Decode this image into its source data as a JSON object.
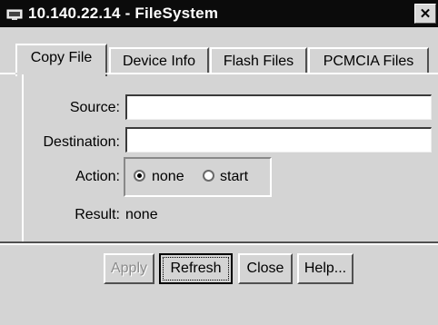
{
  "window": {
    "title": "10.140.22.14 - FileSystem",
    "close_glyph": "✕",
    "icon": "monitor-icon"
  },
  "tabs": [
    {
      "label": "Copy File",
      "active": true
    },
    {
      "label": "Device Info",
      "active": false
    },
    {
      "label": "Flash Files",
      "active": false
    },
    {
      "label": "PCMCIA Files",
      "active": false
    }
  ],
  "copy_file": {
    "source_label": "Source:",
    "source_value": "",
    "destination_label": "Destination:",
    "destination_value": "",
    "action_label": "Action:",
    "action_options": [
      {
        "label": "none",
        "selected": true
      },
      {
        "label": "start",
        "selected": false
      }
    ],
    "result_label": "Result:",
    "result_value": "none"
  },
  "buttons": {
    "apply": "Apply",
    "refresh": "Refresh",
    "close": "Close",
    "help": "Help..."
  },
  "colors": {
    "titlebar": "#0b0b0b",
    "face": "#d4d4d4"
  }
}
